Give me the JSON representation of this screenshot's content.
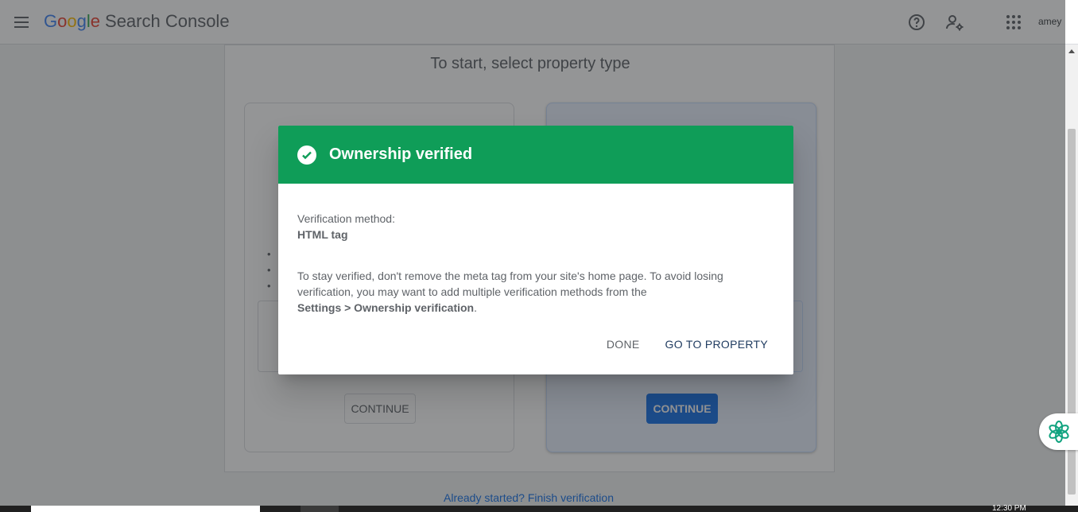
{
  "header": {
    "brand_google": "Google",
    "brand_product": "Search Console",
    "avatar_text": "amey"
  },
  "background": {
    "title": "To start, select property type",
    "left_continue": "CONTINUE",
    "right_continue": "CONTINUE",
    "finish_link": "Already started? Finish verification"
  },
  "dialog": {
    "title": "Ownership verified",
    "method_label": "Verification method:",
    "method_value": "HTML tag",
    "para_text": "To stay verified, don't remove the meta tag from your site's home page. To avoid losing verification, you may want to add multiple verification methods from the",
    "para_link": "Settings > Ownership verification",
    "para_end": ".",
    "done_label": "DONE",
    "go_label": "GO TO PROPERTY"
  },
  "taskbar": {
    "clock": "12:30 PM"
  },
  "colors": {
    "success": "#0f9d58",
    "primary": "#1a73e8"
  }
}
